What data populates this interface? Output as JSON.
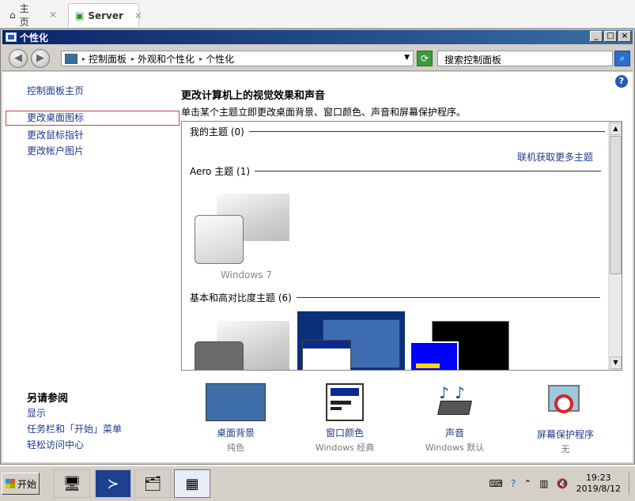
{
  "tabs": [
    {
      "label": "主页",
      "icon": "home-icon"
    },
    {
      "label": "Server",
      "icon": "vm-icon"
    }
  ],
  "window": {
    "title": "个性化",
    "buttons": [
      "_",
      "□",
      "×"
    ]
  },
  "nav": {
    "back_icon": "back-arrow-icon",
    "forward_icon": "forward-arrow-icon",
    "breadcrumbs": [
      "控制面板",
      "外观和个性化",
      "个性化"
    ],
    "search_placeholder": "搜索控制面板"
  },
  "sidebar": {
    "home_link": "控制面板主页",
    "links": [
      "更改桌面图标",
      "更改鼠标指针",
      "更改帐户图片"
    ],
    "see_also_title": "另请参阅",
    "see_also": [
      "显示",
      "任务栏和「开始」菜单",
      "轻松访问中心"
    ]
  },
  "main": {
    "heading": "更改计算机上的视觉效果和声音",
    "subheading": "单击某个主题立即更改桌面背景、窗口颜色、声音和屏幕保护程序。",
    "sections": {
      "my_themes": "我的主题 (0)",
      "get_more": "联机获取更多主题",
      "aero": "Aero 主题 (1)",
      "aero_theme_name": "Windows 7",
      "basic": "基本和高对比度主题 (6)"
    }
  },
  "tiles": [
    {
      "label": "桌面背景",
      "value": "纯色",
      "icon": "desktop-background-icon"
    },
    {
      "label": "窗口颜色",
      "value": "Windows 经典",
      "icon": "window-color-icon"
    },
    {
      "label": "声音",
      "value": "Windows 默认",
      "icon": "sound-icon"
    },
    {
      "label": "屏幕保护程序",
      "value": "无",
      "icon": "screensaver-icon"
    }
  ],
  "taskbar": {
    "start_label": "开始",
    "time": "19:23",
    "date": "2019/8/12"
  }
}
